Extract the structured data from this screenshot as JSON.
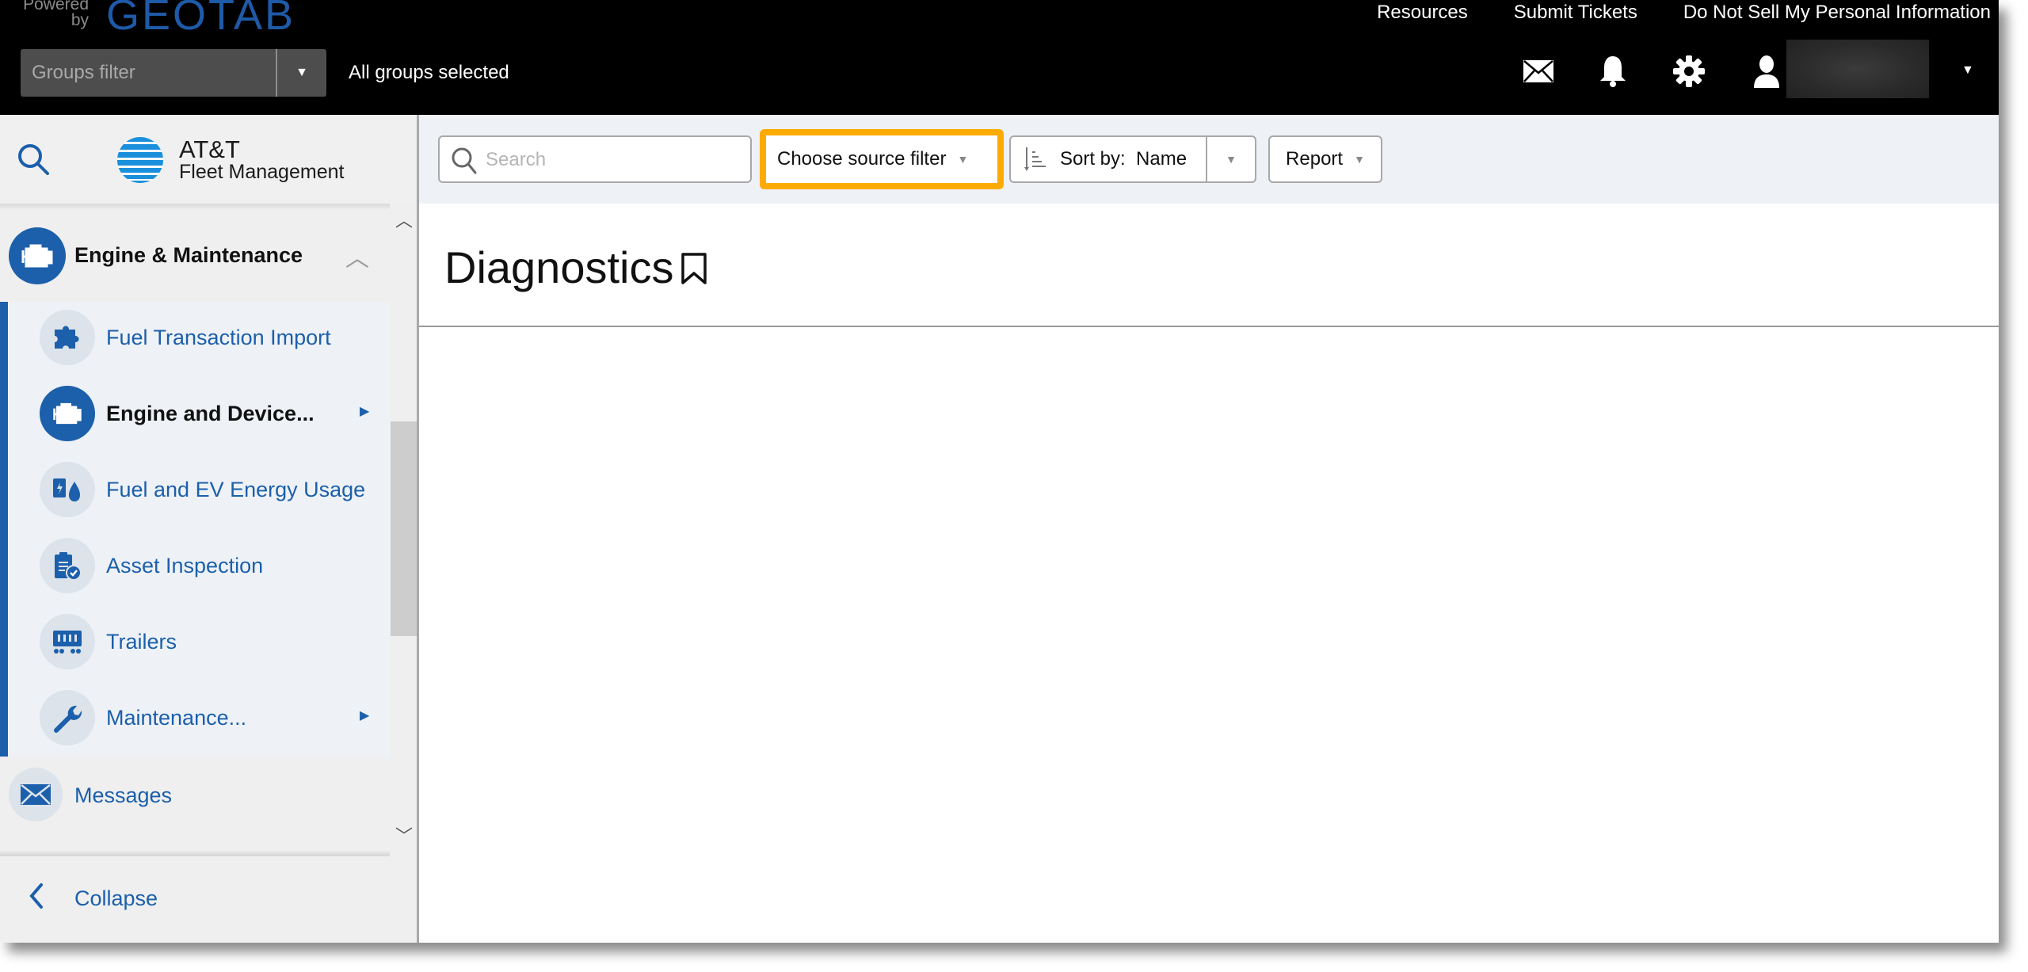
{
  "header": {
    "powered_by": "Powered by",
    "brand": "GEOTAB",
    "links": [
      "Resources",
      "Submit Tickets",
      "Do Not Sell My Personal Information"
    ],
    "groups_filter": {
      "placeholder": "Groups filter",
      "status": "All groups selected"
    },
    "icons": [
      "mail-icon",
      "bell-icon",
      "gear-icon",
      "user-icon"
    ]
  },
  "sidebar": {
    "logo": {
      "title": "AT&T",
      "subtitle": "Fleet Management"
    },
    "category": {
      "label": "Engine & Maintenance",
      "expanded": true
    },
    "items": [
      {
        "label": "Fuel Transaction Import",
        "icon": "puzzle-icon",
        "active": false,
        "has_submenu": false
      },
      {
        "label": "Engine and Device...",
        "icon": "engine-icon",
        "active": true,
        "has_submenu": true
      },
      {
        "label": "Fuel and EV Energy Usage",
        "icon": "fuel-ev-icon",
        "active": false,
        "has_submenu": false
      },
      {
        "label": "Asset Inspection",
        "icon": "clipboard-check-icon",
        "active": false,
        "has_submenu": false
      },
      {
        "label": "Trailers",
        "icon": "trailer-icon",
        "active": false,
        "has_submenu": false
      },
      {
        "label": "Maintenance...",
        "icon": "wrench-icon",
        "active": false,
        "has_submenu": true
      }
    ],
    "messages": {
      "label": "Messages"
    },
    "collapse": {
      "label": "Collapse"
    }
  },
  "toolbar": {
    "search_placeholder": "Search",
    "source_filter": "Choose source filter",
    "sort_label": "Sort by:",
    "sort_value": "Name",
    "report": "Report"
  },
  "page": {
    "title": "Diagnostics"
  },
  "colors": {
    "brand_blue": "#1c5fab",
    "highlight": "#fdab00",
    "header_bg": "#000000"
  }
}
